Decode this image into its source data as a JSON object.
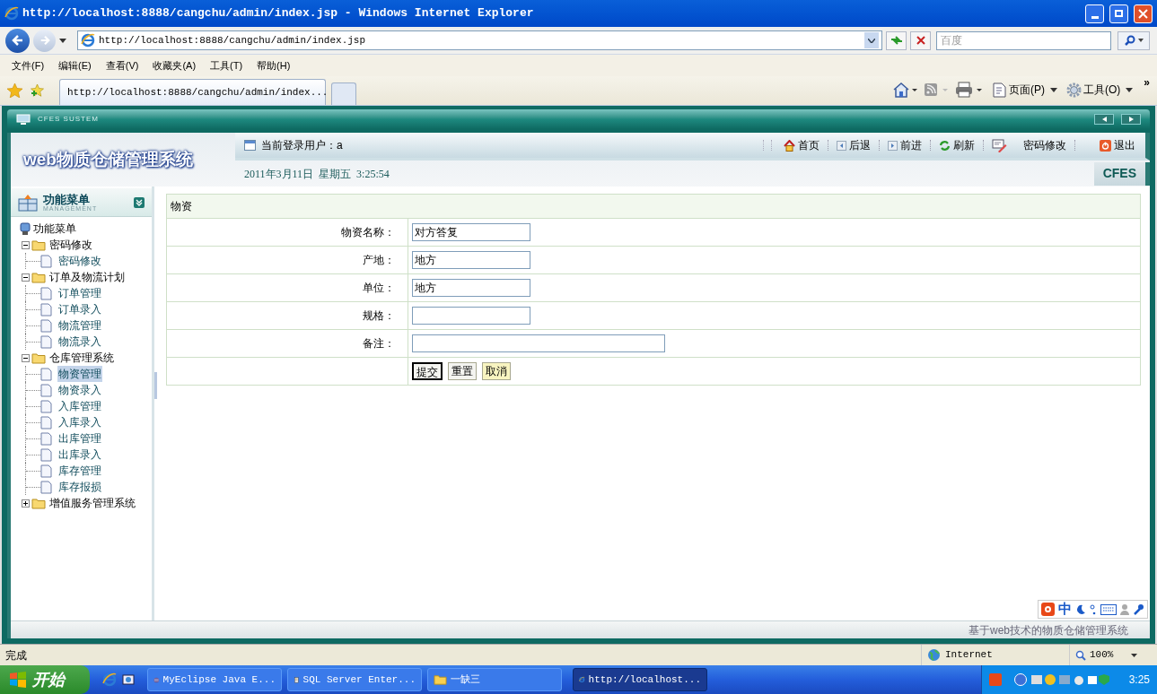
{
  "window": {
    "title": "http://localhost:8888/cangchu/admin/index.jsp - Windows Internet Explorer"
  },
  "address_bar": {
    "value": "http://localhost:8888/cangchu/admin/index.jsp"
  },
  "search": {
    "placeholder": "百度"
  },
  "menu": [
    "文件(F)",
    "编辑(E)",
    "查看(V)",
    "收藏夹(A)",
    "工具(T)",
    "帮助(H)"
  ],
  "tab": {
    "title": "http://localhost:8888/cangchu/admin/index..."
  },
  "command_bar": [
    {
      "kind": "page",
      "label": "页面(P)"
    },
    {
      "kind": "tools",
      "label": "工具(O)"
    }
  ],
  "command_overflow": "»",
  "app": {
    "brand": "CFES SUSTEM",
    "title": "web物质仓储管理系统",
    "user": "当前登录用户：a",
    "date": "2011年3月11日  星期五  3:25:54",
    "logo": "CFES",
    "nav": [
      {
        "kind": "home",
        "label": "首页"
      },
      {
        "kind": "back",
        "label": "后退"
      },
      {
        "kind": "forward",
        "label": "前进"
      },
      {
        "kind": "refresh",
        "label": "刷新"
      },
      {
        "kind": "edit",
        "label": "密码修改"
      },
      {
        "kind": "logout",
        "label": "退出"
      }
    ]
  },
  "sidebar": {
    "title": "功能菜单",
    "subtitle": "MANAGEMENT",
    "root": "功能菜单",
    "tree": [
      {
        "label": "密码修改",
        "expanded": true,
        "children": [
          {
            "label": "密码修改",
            "selected": false
          }
        ]
      },
      {
        "label": "订单及物流计划",
        "expanded": true,
        "children": [
          {
            "label": "订单管理",
            "selected": false
          },
          {
            "label": "订单录入",
            "selected": false
          },
          {
            "label": "物流管理",
            "selected": false
          },
          {
            "label": "物流录入",
            "selected": false
          }
        ]
      },
      {
        "label": "仓库管理系统",
        "expanded": true,
        "children": [
          {
            "label": "物资管理",
            "selected": true
          },
          {
            "label": "物资录入",
            "selected": false
          },
          {
            "label": "入库管理",
            "selected": false
          },
          {
            "label": "入库录入",
            "selected": false
          },
          {
            "label": "出库管理",
            "selected": false
          },
          {
            "label": "出库录入",
            "selected": false
          },
          {
            "label": "库存管理",
            "selected": false
          },
          {
            "label": "库存报损",
            "selected": false
          }
        ]
      },
      {
        "label": "增值服务管理系统",
        "expanded": false
      }
    ]
  },
  "form": {
    "header": "物资",
    "fields": [
      {
        "label": "物资名称：",
        "value": "对方答复",
        "kind": "short"
      },
      {
        "label": "产地：",
        "value": "地方",
        "kind": "short"
      },
      {
        "label": "单位：",
        "value": "地方",
        "kind": "short"
      },
      {
        "label": "规格：",
        "kind": "short"
      },
      {
        "label": "备注：",
        "kind": "wide"
      }
    ],
    "buttons": [
      {
        "label": "提交",
        "kind": "focused"
      },
      {
        "label": "重置",
        "kind": "normal"
      },
      {
        "label": "取消",
        "kind": "highlight"
      }
    ]
  },
  "footer": "基于web技术的物质仓储管理系统",
  "ime": {
    "label": "中"
  },
  "status_bar": {
    "text": "完成",
    "zone": "Internet",
    "zoom": "100%"
  },
  "taskbar": {
    "start": "开始",
    "tasks": [
      {
        "label": "MyEclipse Java E...",
        "kind": "eclipse",
        "selected": false
      },
      {
        "label": "SQL Server Enter...",
        "kind": "sql",
        "selected": false
      },
      {
        "label": "一缺三",
        "kind": "folder",
        "selected": false
      },
      {
        "label": "http://localhost...",
        "kind": "ie",
        "selected": true
      }
    ],
    "clock": "3:25"
  }
}
